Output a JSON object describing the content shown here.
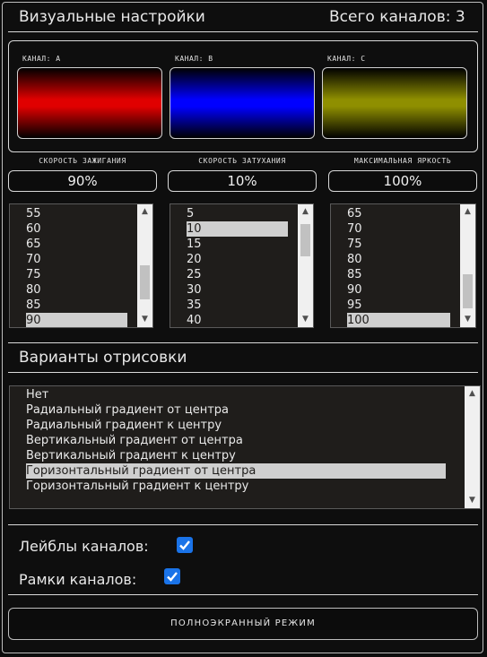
{
  "header": {
    "title": "Визуальные настройки",
    "channel_count": "Всего каналов: 3"
  },
  "channels": [
    {
      "label": "канал: A",
      "color": "#e00000"
    },
    {
      "label": "канал: B",
      "color": "#0000ff"
    },
    {
      "label": "канал: C",
      "color": "#8f8f00"
    }
  ],
  "params": {
    "ignition": {
      "title": "скорость зажигания",
      "value": "90%",
      "visible_items": [
        "55",
        "60",
        "65",
        "70",
        "75",
        "80",
        "85",
        "90"
      ],
      "selected": "90"
    },
    "fade": {
      "title": "скорость затухания",
      "value": "10%",
      "visible_items": [
        "5",
        "10",
        "15",
        "20",
        "25",
        "30",
        "35",
        "40"
      ],
      "selected": "10"
    },
    "brightness": {
      "title": "максимальная яркость",
      "value": "100%",
      "visible_items": [
        "65",
        "70",
        "75",
        "80",
        "85",
        "90",
        "95",
        "100"
      ],
      "selected": "100"
    }
  },
  "render": {
    "title": "Варианты отрисовки",
    "options": [
      "Нет",
      "Радиальный градиент от центра",
      "Радиальный градиент к центру",
      "Вертикальный градиент от центра",
      "Вертикальный градиент к центру",
      "Горизонтальный градиент от центра",
      "Горизонтальный градиент к центру"
    ],
    "selected": "Горизонтальный градиент от центра"
  },
  "options": {
    "labels": {
      "label": "Лейблы каналов:",
      "checked": true
    },
    "frames": {
      "label": "Рамки каналов:",
      "checked": true
    }
  },
  "fullscreen_button": "полноэкранный режим",
  "colors": {
    "accent": "#1a73e8",
    "background": "#0e0e0e",
    "selection": "#cfcfcf"
  }
}
